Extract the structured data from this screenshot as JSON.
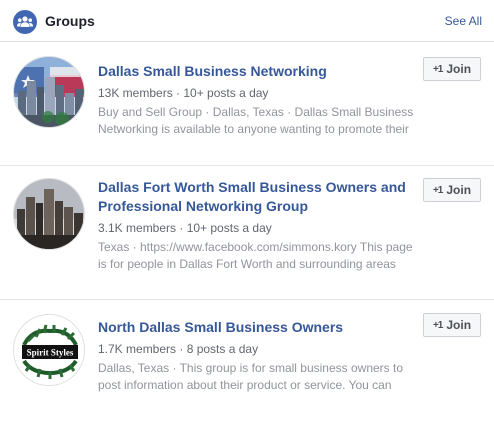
{
  "header": {
    "title": "Groups",
    "see_all": "See All",
    "icon": "groups-icon"
  },
  "colors": {
    "link": "#365899",
    "accent": "#4267b2",
    "meta_text": "#616770",
    "desc_text": "#90949c"
  },
  "groups": [
    {
      "name": "Dallas Small Business Networking",
      "stats": "13K members · 10+ posts a day",
      "description": "Buy and Sell Group · Dallas, Texas · Dallas Small Business Networking is available to anyone wanting to promote their business and network....",
      "join_icon": "+1",
      "join_label": "Join",
      "image": "dallas-skyline-flag-photo"
    },
    {
      "name": "Dallas Fort Worth Small Business Owners and Professional Networking Group",
      "stats": "3.1K members · 10+ posts a day",
      "description": "Texas · https://www.facebook.com/simmons.kory This page is for people in Dallas Fort Worth and surrounding areas business owners and...",
      "join_icon": "+1",
      "join_label": "Join",
      "image": "dallas-skyline-photo"
    },
    {
      "name": "North Dallas Small Business Owners",
      "stats": "1.7K members · 8 posts a day",
      "description": "Dallas, Texas · This group is for small business owners to post information about their product or service. You can also post job listin...",
      "join_icon": "+1",
      "join_label": "Join",
      "image": "spirit-styles-logo",
      "logo_text": "Spirit Styles"
    }
  ]
}
